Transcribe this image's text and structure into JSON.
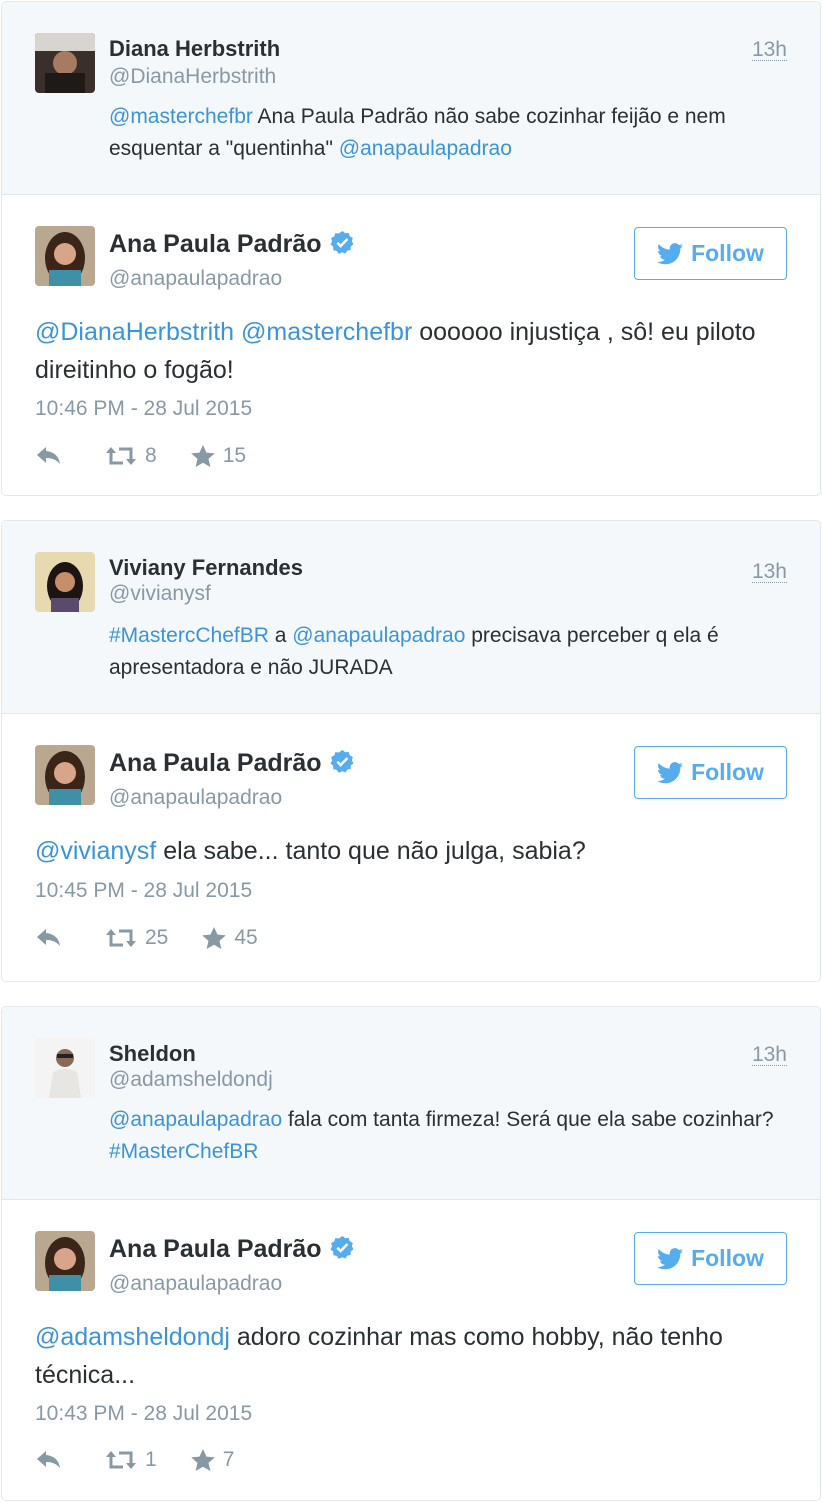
{
  "brand": {
    "accent": "#55acee",
    "link": "#3b94d9",
    "muted": "#8899a6"
  },
  "threads": [
    {
      "parent": {
        "name": "Diana Herbstrith",
        "handle": "@DianaHerbstrith",
        "time": "13h",
        "text": [
          {
            "t": "@masterchefbr",
            "m": true
          },
          {
            "t": " Ana Paula Padrão não sabe cozinhar feijão e nem esquentar  a \"quentinha\" ",
            "m": false
          },
          {
            "t": "@anapaulapadrao",
            "m": true
          }
        ]
      },
      "reply": {
        "name": "Ana Paula Padrão",
        "handle": "@anapaulapadrao",
        "follow_label": "Follow",
        "text": [
          {
            "t": "@DianaHerbstrith",
            "m": true
          },
          {
            "t": " ",
            "m": false
          },
          {
            "t": "@masterchefbr",
            "m": true
          },
          {
            "t": " oooooo injustiça , sô! eu piloto direitinho o fogão!",
            "m": false
          }
        ],
        "date": "10:46 PM - 28 Jul 2015",
        "retweets": "8",
        "favorites": "15"
      }
    },
    {
      "parent": {
        "name": "Viviany Fernandes",
        "handle": "@vivianysf",
        "time": "13h",
        "text": [
          {
            "t": "#MastercChefBR",
            "m": true
          },
          {
            "t": " a ",
            "m": false
          },
          {
            "t": "@anapaulapadrao",
            "m": true
          },
          {
            "t": " precisava perceber q ela é apresentadora e não JURADA",
            "m": false
          }
        ]
      },
      "reply": {
        "name": "Ana Paula Padrão",
        "handle": "@anapaulapadrao",
        "follow_label": "Follow",
        "text": [
          {
            "t": "@vivianysf",
            "m": true
          },
          {
            "t": " ela sabe... tanto que não julga, sabia?",
            "m": false
          }
        ],
        "date": "10:45 PM - 28 Jul 2015",
        "retweets": "25",
        "favorites": "45"
      }
    },
    {
      "parent": {
        "name": "Sheldon",
        "handle": "@adamsheldondj",
        "time": "13h",
        "text": [
          {
            "t": "@anapaulapadrao",
            "m": true
          },
          {
            "t": " fala com tanta firmeza! Será que ela sabe cozinhar? ",
            "m": false
          },
          {
            "t": "#MasterChefBR",
            "m": true
          }
        ]
      },
      "reply": {
        "name": "Ana Paula Padrão",
        "handle": "@anapaulapadrao",
        "follow_label": "Follow",
        "text": [
          {
            "t": "@adamsheldondj",
            "m": true
          },
          {
            "t": " adoro cozinhar mas como hobby, não tenho técnica...",
            "m": false
          }
        ],
        "date": "10:43 PM - 28 Jul 2015",
        "retweets": "1",
        "favorites": "7"
      }
    }
  ]
}
